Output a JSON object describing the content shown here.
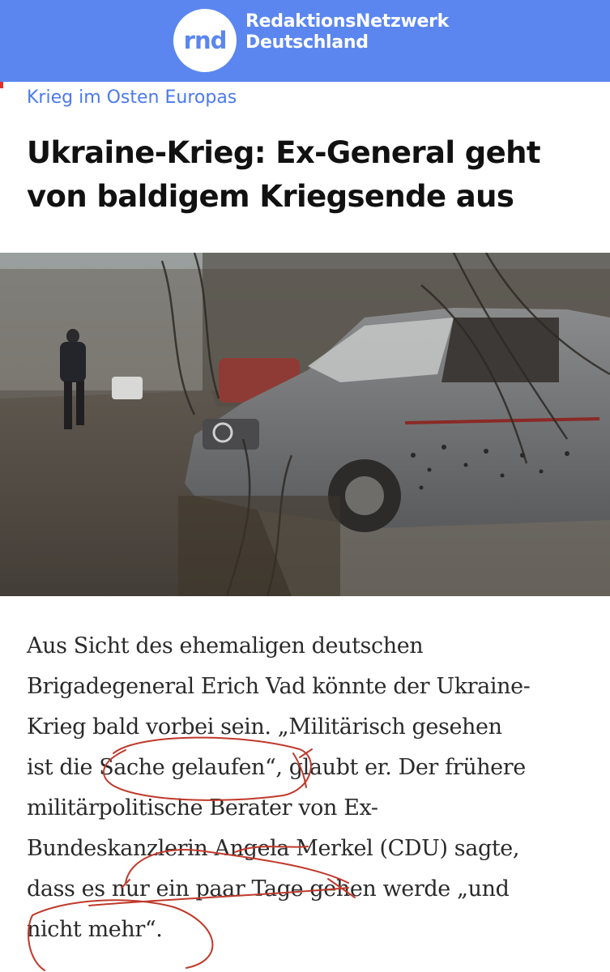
{
  "header": {
    "logo_text": "rnd",
    "brand_line1": "RedaktionsNetzwerk",
    "brand_line2": "Deutschland",
    "background_color": "#5b86f0"
  },
  "article": {
    "kicker": "Krieg im Osten Europas",
    "headline_lines": [
      "Ukraine-Krieg: Ex-General geht",
      "von baldigem Kriegsende aus"
    ],
    "photo_icon": "chevron-down-icon",
    "body_lines": [
      "Aus Sicht des ehemaligen deutschen",
      "Brigadegeneral Erich Vad könnte der Ukraine-",
      "Krieg bald vorbei sein. „Militärisch gesehen",
      "ist die Sache gelaufen“, glaubt er. Der frühere",
      "militärpolitische Berater von Ex-",
      "Bundeskanzlerin Angela Merkel (CDU) sagte,",
      "dass es nur ein paar Tage gehen werde „und",
      "nicht mehr“."
    ]
  },
  "colors": {
    "accent": "#4b79ee",
    "annotation_red": "#c0392b"
  }
}
